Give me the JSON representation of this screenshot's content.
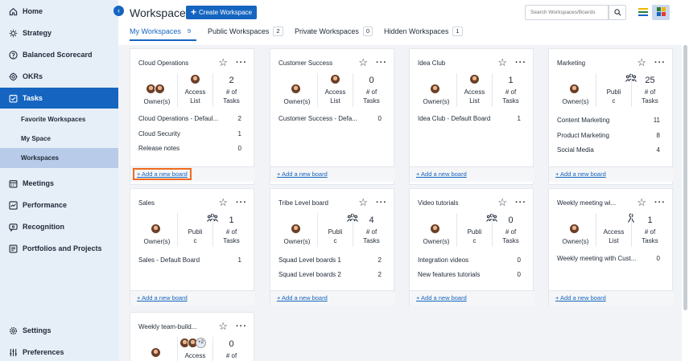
{
  "sidebar": {
    "collapse_icon": "chevron-left-icon",
    "items": [
      {
        "label": "Home",
        "icon": "home-icon"
      },
      {
        "label": "Strategy",
        "icon": "strategy-icon"
      },
      {
        "label": "Balanced Scorecard",
        "icon": "scorecard-icon"
      },
      {
        "label": "OKRs",
        "icon": "target-icon"
      },
      {
        "label": "Tasks",
        "icon": "tasks-icon"
      },
      {
        "label": "Meetings",
        "icon": "calendar-icon"
      },
      {
        "label": "Performance",
        "icon": "performance-icon"
      },
      {
        "label": "Recognition",
        "icon": "recognition-icon"
      },
      {
        "label": "Portfolios and Projects",
        "icon": "portfolio-icon"
      },
      {
        "label": "Settings",
        "icon": "gear-icon"
      },
      {
        "label": "Preferences",
        "icon": "sliders-icon"
      }
    ],
    "sub_items": [
      {
        "label": "Favorite Workspaces"
      },
      {
        "label": "My Space"
      },
      {
        "label": "Workspaces"
      }
    ]
  },
  "header": {
    "title": "Workspaces",
    "create_label": "Create Workspace",
    "search_placeholder": "Search Workspaces/Boards"
  },
  "tabs": [
    {
      "label": "My Workspaces",
      "count": "9"
    },
    {
      "label": "Public Workspaces",
      "count": "2"
    },
    {
      "label": "Private Workspaces",
      "count": "0"
    },
    {
      "label": "Hidden Workspaces",
      "count": "1"
    }
  ],
  "labels": {
    "owner": "Owner(s)",
    "access_list": "Access List",
    "access": "Access",
    "list": "List",
    "public1": "Publi",
    "public2": "c",
    "tasks1": "# of",
    "tasks2": "Tasks",
    "add_board": "+ Add a new board",
    "more_count": "+2"
  },
  "cards": [
    {
      "name": "Cloud Operations",
      "access": "list",
      "tasks": "2",
      "boards": [
        {
          "name": "Cloud Operations - Defaul...",
          "count": "2"
        },
        {
          "name": "Cloud Security",
          "count": "1"
        },
        {
          "name": "Release notes",
          "count": "0"
        }
      ]
    },
    {
      "name": "Customer Success",
      "access": "list",
      "tasks": "0",
      "boards": [
        {
          "name": "Customer Success - Defa...",
          "count": "0"
        }
      ]
    },
    {
      "name": "Idea Club",
      "access": "list",
      "tasks": "1",
      "boards": [
        {
          "name": "Idea Club - Default Board",
          "count": "1"
        }
      ]
    },
    {
      "name": "Marketing",
      "access": "public",
      "tasks": "25",
      "boards": [
        {
          "name": "Content Marketing",
          "count": "11"
        },
        {
          "name": "Product Marketing",
          "count": "8"
        },
        {
          "name": "Social Media",
          "count": "4"
        }
      ]
    },
    {
      "name": "Sales",
      "access": "public",
      "tasks": "1",
      "boards": [
        {
          "name": "Sales - Default Board",
          "count": "1"
        }
      ]
    },
    {
      "name": "Tribe Level board",
      "access": "public",
      "tasks": "4",
      "boards": [
        {
          "name": "Squad Level boards 1",
          "count": "2"
        },
        {
          "name": "Squad Level boards 2",
          "count": "2"
        }
      ]
    },
    {
      "name": "Video tutorials",
      "access": "public",
      "tasks": "0",
      "boards": [
        {
          "name": "Integration videos",
          "count": "0"
        },
        {
          "name": "New features tutorials",
          "count": "0"
        }
      ]
    },
    {
      "name": "Weekly meeting wi...",
      "access": "list",
      "tasks": "1",
      "boards": [
        {
          "name": "Weekly meeting with Cust...",
          "count": "0"
        }
      ]
    },
    {
      "name": "Weekly team-build...",
      "access": "list",
      "tasks": "0",
      "boards": []
    }
  ],
  "colors": {
    "accent": "#1565c0",
    "highlight": "#f06a1d",
    "sidebar_bg": "#e6eef8"
  }
}
